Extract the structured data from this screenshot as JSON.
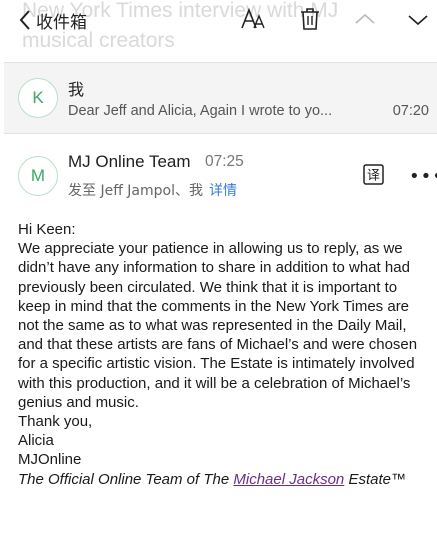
{
  "toolbar": {
    "back_label": "收件箱",
    "ghost_subject_line1": "New York Times interview with MJ",
    "ghost_subject_line2": "musical creators"
  },
  "collapsed_message": {
    "avatar_letter": "K",
    "sender": "我",
    "preview": "Dear Jeff and Alicia, Again I wrote to yo...",
    "time": "07:20"
  },
  "message": {
    "avatar_letter": "M",
    "sender": "MJ Online Team",
    "time": "07:25",
    "recipients": "发至 Jeff Jampol、我",
    "details_link": "详情",
    "translate_icon_label": "译"
  },
  "body": {
    "greeting": "Hi Keen:",
    "paragraph": "We appreciate your patience in allowing us to reply, as we didn’t have any information to share in addition to what had previously been circulated. We think that it is important to keep in mind that the comments in the New York Times are not the same as to what was represented in the Daily Mail, and that these artists are fans of Michael’s and were chosen for a specific artistic vision. The Estate is intimately involved with this production, and it will be a celebration of Michael’s genius and music.",
    "closing": "Thank you,",
    "closing_name": "Alicia",
    "signature_name": "MJOnline",
    "signature_prefix": "The Official Online Team of The ",
    "signature_link": "Michael Jackson",
    "signature_suffix": " Estate™"
  },
  "colors": {
    "avatar_green": "#3aa866",
    "link_blue": "#3a7bd5",
    "link_purple": "#6b2c91",
    "collapsed_bg": "#f4f4f4"
  }
}
